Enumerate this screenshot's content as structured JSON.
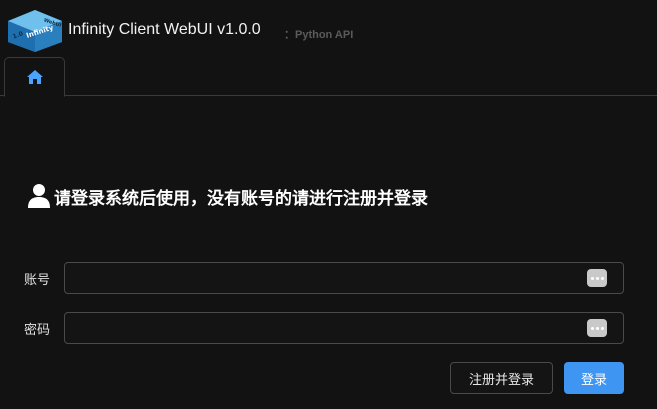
{
  "header": {
    "title": "Infinity Client WebUI v1.0.0",
    "subtitle": "：Python API",
    "logo": {
      "version_text": "1.0",
      "brand_text": "Infinity",
      "tag_text": "WebUI"
    }
  },
  "tabs": [
    {
      "icon": "home-icon",
      "active": true
    }
  ],
  "login": {
    "notice": "请登录系统后使用，没有账号的请进行注册并登录",
    "fields": {
      "account": {
        "label": "账号",
        "value": "",
        "placeholder": ""
      },
      "password": {
        "label": "密码",
        "value": "",
        "placeholder": ""
      }
    },
    "buttons": {
      "register": "注册并登录",
      "login": "登录"
    }
  },
  "colors": {
    "background": "#121212",
    "accent": "#3f95f2",
    "border": "#4a4a4a",
    "home_icon": "#4aa3ff"
  }
}
